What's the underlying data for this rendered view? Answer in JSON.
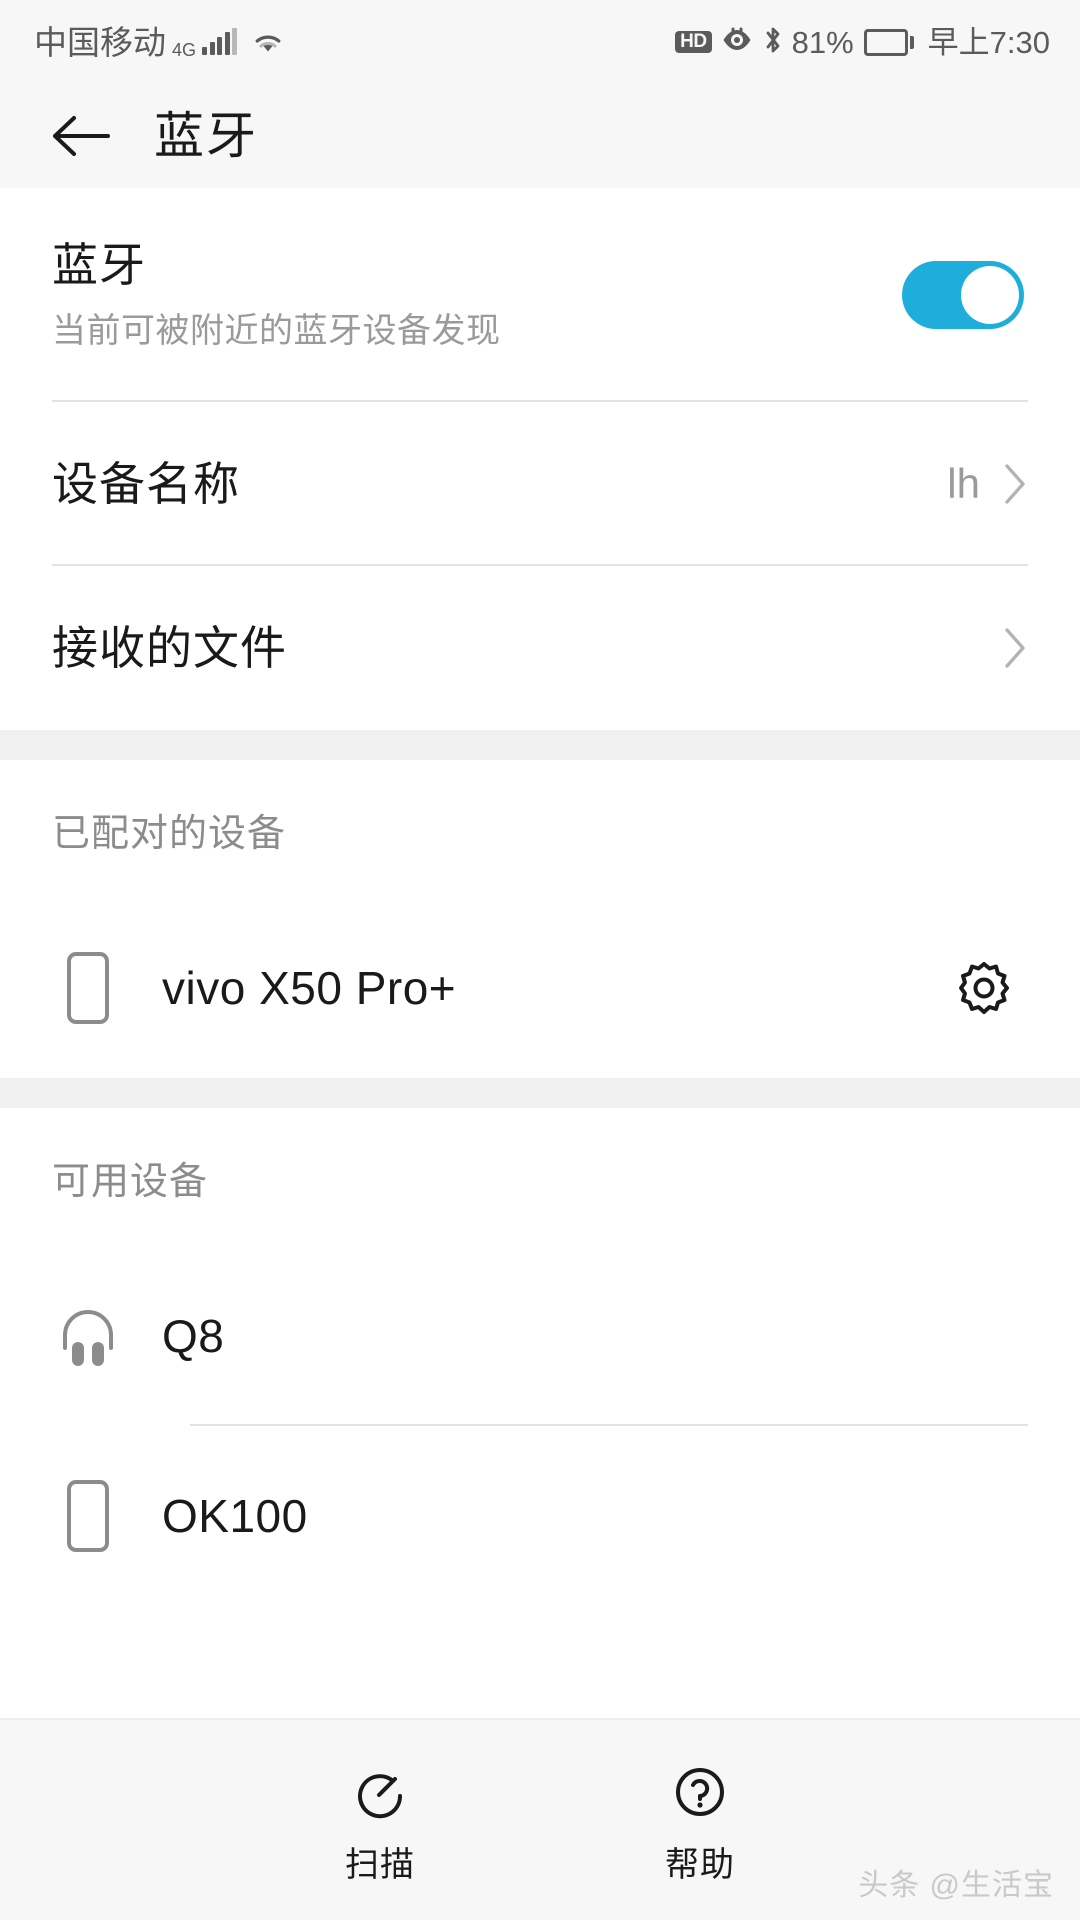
{
  "status_bar": {
    "carrier": "中国移动",
    "network_type": "4G",
    "hd_badge": "HD",
    "battery_percent": "81%",
    "clock": "早上7:30",
    "icons": [
      "signal-icon",
      "wifi-icon",
      "hd-icon",
      "eye-comfort-icon",
      "bluetooth-icon",
      "battery-icon"
    ]
  },
  "app_bar": {
    "back_label": "back-arrow",
    "title": "蓝牙"
  },
  "bluetooth": {
    "title": "蓝牙",
    "subtitle": "当前可被附近的蓝牙设备发现",
    "enabled": true,
    "accent_color": "#1FAEDC"
  },
  "settings_rows": [
    {
      "label": "设备名称",
      "value": "lh"
    },
    {
      "label": "接收的文件",
      "value": ""
    }
  ],
  "paired_section": {
    "header": "已配对的设备",
    "devices": [
      {
        "name": "vivo X50 Pro+",
        "icon": "phone-icon",
        "has_settings": true
      }
    ]
  },
  "available_section": {
    "header": "可用设备",
    "devices": [
      {
        "name": "Q8",
        "icon": "headphones-icon",
        "has_settings": false
      },
      {
        "name": "OK100",
        "icon": "phone-icon",
        "has_settings": false
      }
    ]
  },
  "bottom_bar": {
    "items": [
      {
        "label": "扫描",
        "icon": "refresh-scan-icon"
      },
      {
        "label": "帮助",
        "icon": "question-circle-icon"
      }
    ]
  },
  "watermark": "头条 @生活宝"
}
